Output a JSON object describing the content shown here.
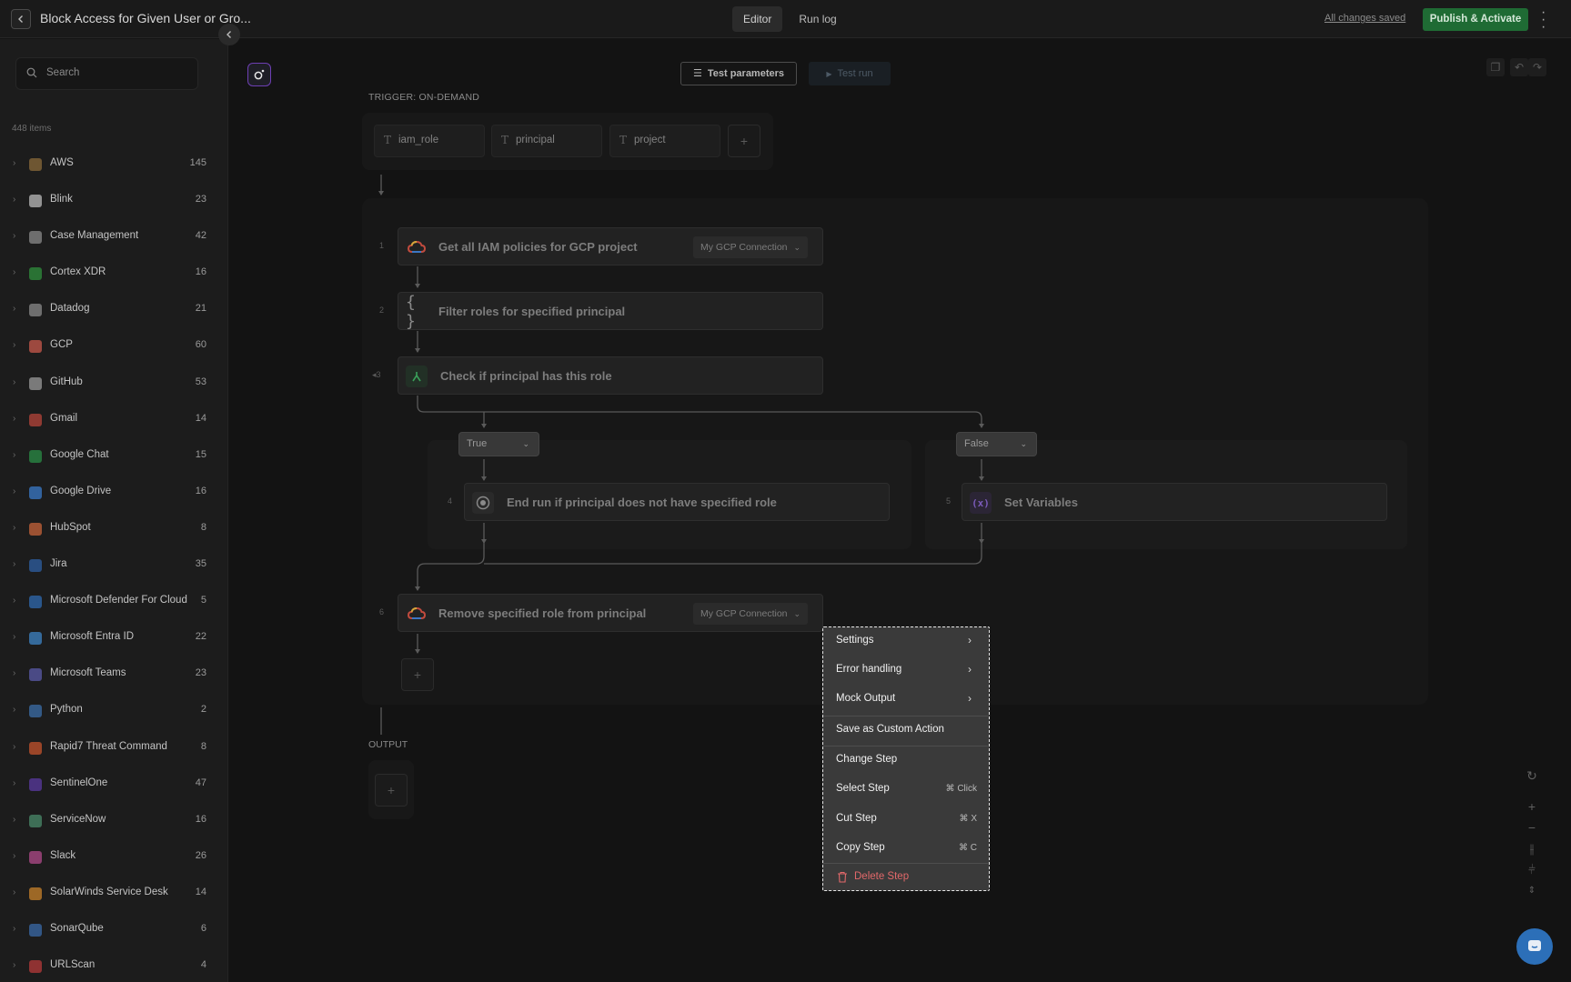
{
  "header": {
    "title": "Block Access for Given User or Gro...",
    "tabs": [
      "Editor",
      "Run log"
    ],
    "active_tab": "Editor",
    "saved_status": "All changes saved",
    "publish_label": "Publish & Activate",
    "colors": {
      "publish": "#1f6b34"
    }
  },
  "sidebar": {
    "search_placeholder": "Search",
    "items_count": "448 items",
    "integrations": [
      {
        "name": "AWS",
        "count": "145",
        "color": "#8a6a3a"
      },
      {
        "name": "Blink",
        "count": "23",
        "color": "#b9b9b9"
      },
      {
        "name": "Case Management",
        "count": "42",
        "color": "#8a8a8a"
      },
      {
        "name": "Cortex XDR",
        "count": "16",
        "color": "#2f8f3c"
      },
      {
        "name": "Datadog",
        "count": "21",
        "color": "#8a8a8a"
      },
      {
        "name": "GCP",
        "count": "60",
        "color": "#c8584b"
      },
      {
        "name": "GitHub",
        "count": "53",
        "color": "#9a9a9a"
      },
      {
        "name": "Gmail",
        "count": "14",
        "color": "#b6443a"
      },
      {
        "name": "Google Chat",
        "count": "15",
        "color": "#2a8c45"
      },
      {
        "name": "Google Drive",
        "count": "16",
        "color": "#3a7ac8"
      },
      {
        "name": "HubSpot",
        "count": "8",
        "color": "#c5633a"
      },
      {
        "name": "Jira",
        "count": "35",
        "color": "#2e5fa3"
      },
      {
        "name": "Microsoft Defender For Cloud",
        "count": "5",
        "color": "#2f69b0"
      },
      {
        "name": "Microsoft Entra ID",
        "count": "22",
        "color": "#3d84c6"
      },
      {
        "name": "Microsoft Teams",
        "count": "23",
        "color": "#5a5aa8"
      },
      {
        "name": "Python",
        "count": "2",
        "color": "#3b6ea8"
      },
      {
        "name": "Rapid7 Threat Command",
        "count": "8",
        "color": "#c4532c"
      },
      {
        "name": "SentinelOne",
        "count": "47",
        "color": "#5a3aa0"
      },
      {
        "name": "ServiceNow",
        "count": "16",
        "color": "#4a8a6a"
      },
      {
        "name": "Slack",
        "count": "26",
        "color": "#b04a8a"
      },
      {
        "name": "SolarWinds Service Desk",
        "count": "14",
        "color": "#c8822a"
      },
      {
        "name": "SonarQube",
        "count": "6",
        "color": "#3a6aa8"
      },
      {
        "name": "URLScan",
        "count": "4",
        "color": "#b63a3a"
      }
    ]
  },
  "toolbar": {
    "test_params_label": "Test parameters",
    "test_run_label": "Test run"
  },
  "trigger": {
    "label": "TRIGGER: ON-DEMAND",
    "params": [
      "iam_role",
      "principal",
      "project"
    ],
    "add": "+"
  },
  "steps": [
    {
      "num": "1",
      "title": "Get all IAM policies for GCP project",
      "connection": "My GCP Connection",
      "icon": "gcp-icon"
    },
    {
      "num": "2",
      "title": "Filter roles for specified principal",
      "icon": "braces-icon"
    },
    {
      "num": "3",
      "title": "Check if principal has this role",
      "icon": "branch-icon"
    },
    {
      "num": "4",
      "title": "End run if principal does not have specified role",
      "icon": "stop-icon"
    },
    {
      "num": "5",
      "title": "Set Variables",
      "icon": "variable-icon"
    },
    {
      "num": "6",
      "title": "Remove specified role from principal",
      "connection": "My GCP Connection",
      "icon": "gcp-icon"
    }
  ],
  "branches": {
    "true_label": "True",
    "false_label": "False"
  },
  "output": {
    "label": "OUTPUT",
    "add": "+"
  },
  "context_menu": {
    "settings": "Settings",
    "error_handling": "Error handling",
    "mock_output": "Mock Output",
    "save_custom": "Save as Custom Action",
    "change_step": "Change Step",
    "select_step": "Select Step",
    "select_shortcut": "⌘ Click",
    "cut_step": "Cut Step",
    "cut_shortcut": "⌘ X",
    "copy_step": "Copy Step",
    "copy_shortcut": "⌘ C",
    "delete_step": "Delete Step",
    "colors": {
      "danger": "#e2686a"
    }
  }
}
